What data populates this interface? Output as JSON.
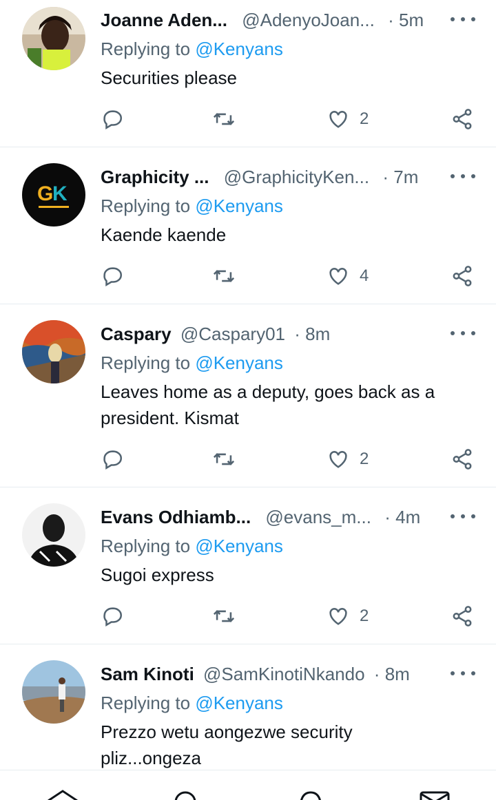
{
  "tweets": [
    {
      "name": "Joanne Aden...",
      "handle": "@AdenyoJoan...",
      "sep": "·",
      "time": "5m",
      "replying": "Replying to",
      "mention": "@Kenyans",
      "text": "Securities please",
      "likes": "2",
      "avatar": "person-photo"
    },
    {
      "name": "Graphicity ...",
      "handle": "@GraphicityKen...",
      "sep": "·",
      "time": "7m",
      "replying": "Replying to",
      "mention": "@Kenyans",
      "text": "Kaende kaende",
      "likes": "4",
      "avatar": "gk-logo"
    },
    {
      "name": "Caspary",
      "handle": "@Caspary01",
      "sep": "·",
      "time": "8m",
      "replying": "Replying to",
      "mention": "@Kenyans",
      "text": "Leaves home as a deputy, goes back as a president. Kismat",
      "likes": "2",
      "avatar": "scream-painting"
    },
    {
      "name": "Evans Odhiamb...",
      "handle": "@evans_m...",
      "sep": "·",
      "time": "4m",
      "replying": "Replying to",
      "mention": "@Kenyans",
      "text": "Sugoi express",
      "likes": "2",
      "avatar": "bw-person-photo"
    },
    {
      "name": "Sam Kinoti",
      "handle": "@SamKinotiNkando",
      "sep": "·",
      "time": "8m",
      "replying": "Replying to",
      "mention": "@Kenyans",
      "text": "Prezzo wetu aongezwe security pliz...ongeza",
      "likes": "",
      "avatar": "landscape-photo"
    }
  ],
  "icons": {
    "reply": "reply-icon",
    "retweet": "retweet-icon",
    "like": "heart-icon",
    "share": "share-icon",
    "more": "more-icon"
  },
  "colors": {
    "accent": "#1d9bf0",
    "muted": "#536471",
    "text": "#0f1419",
    "divider": "#e6ecf0"
  },
  "bottom_nav": [
    "home-icon",
    "search-icon",
    "notifications-icon",
    "messages-icon"
  ]
}
